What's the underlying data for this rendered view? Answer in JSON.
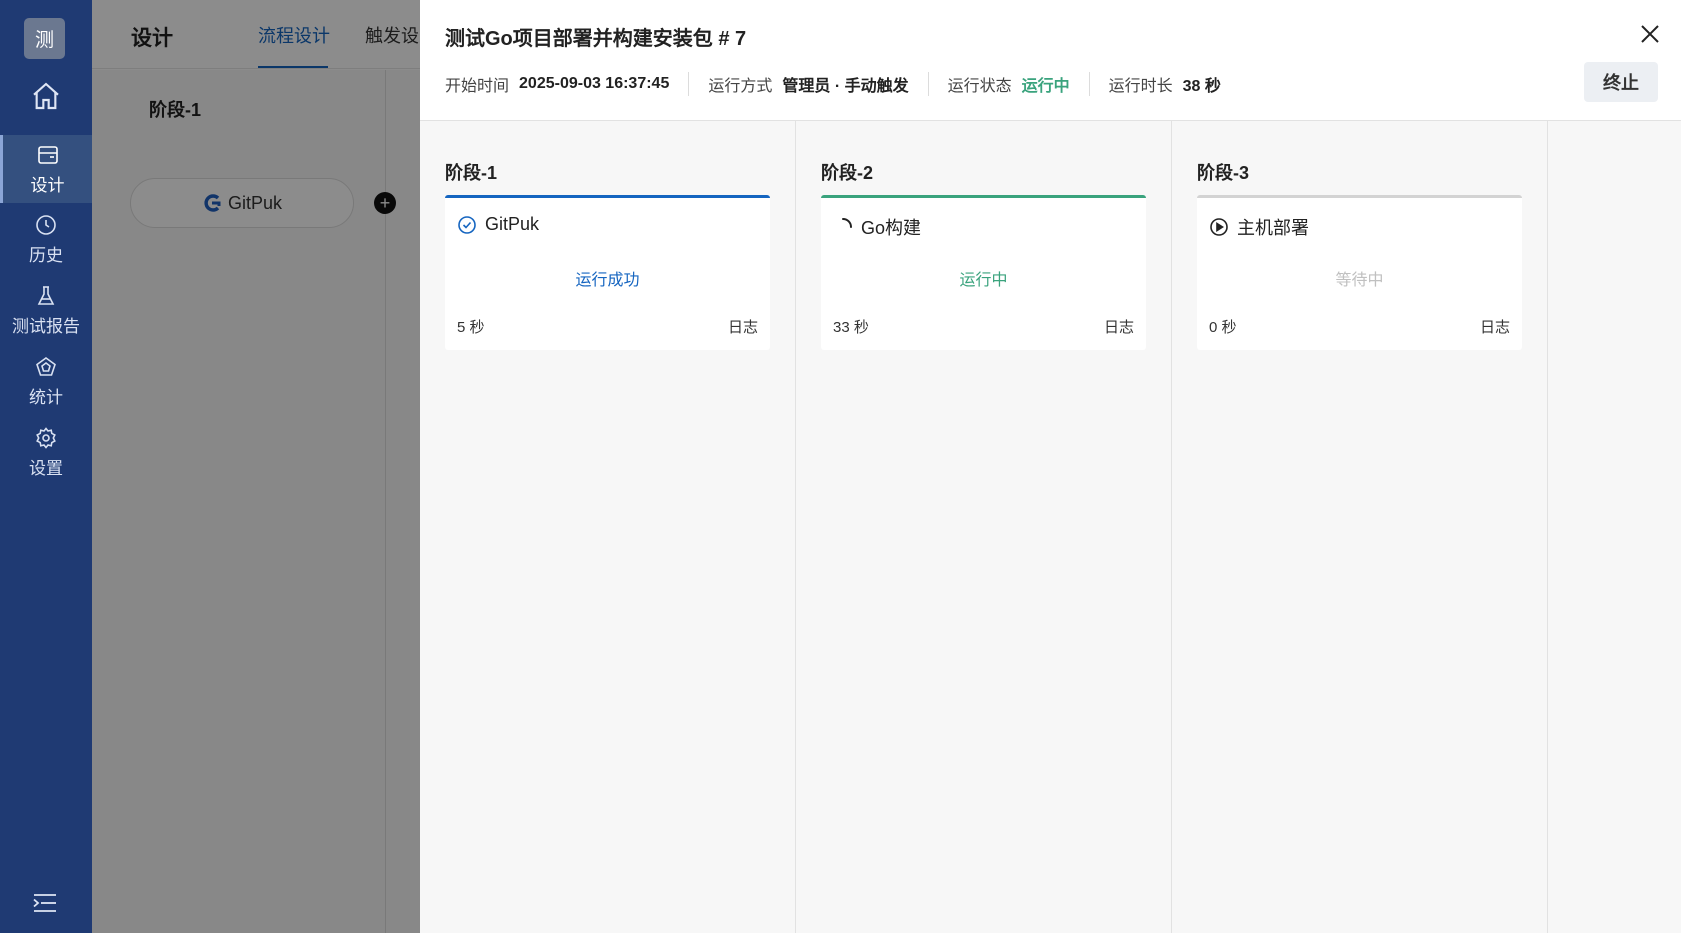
{
  "sidebar": {
    "logo_text": "测",
    "items": [
      {
        "label": "设计",
        "icon": "design-icon"
      },
      {
        "label": "历史",
        "icon": "clock-icon"
      },
      {
        "label": "测试报告",
        "icon": "flask-icon"
      },
      {
        "label": "统计",
        "icon": "chart-icon"
      },
      {
        "label": "设置",
        "icon": "gear-icon"
      }
    ]
  },
  "background_page": {
    "title": "设计",
    "tabs": [
      "流程设计",
      "触发设"
    ],
    "stage_label": "阶段-1",
    "task_chip": "GitPuk",
    "plus": "+"
  },
  "drawer": {
    "title": "测试Go项目部署并构建安装包 # 7",
    "meta": {
      "start_label": "开始时间",
      "start_value": "2025-09-03 16:37:45",
      "mode_label": "运行方式",
      "mode_value": "管理员 · 手动触发",
      "status_label": "运行状态",
      "status_value": "运行中",
      "duration_label": "运行时长",
      "duration_value": "38 秒"
    },
    "stop_button": "终止",
    "stages": [
      {
        "title": "阶段-1",
        "task": "GitPuk",
        "status": "运行成功",
        "duration": "5 秒",
        "log": "日志"
      },
      {
        "title": "阶段-2",
        "task": "Go构建",
        "status": "运行中",
        "duration": "33 秒",
        "log": "日志"
      },
      {
        "title": "阶段-3",
        "task": "主机部署",
        "status": "等待中",
        "duration": "0 秒",
        "log": "日志"
      }
    ]
  },
  "colors": {
    "sidebar_bg": "#1f3a73",
    "accent_blue": "#1565c0",
    "running_green": "#3aa37d",
    "waiting_grey": "#c0c0c0"
  }
}
